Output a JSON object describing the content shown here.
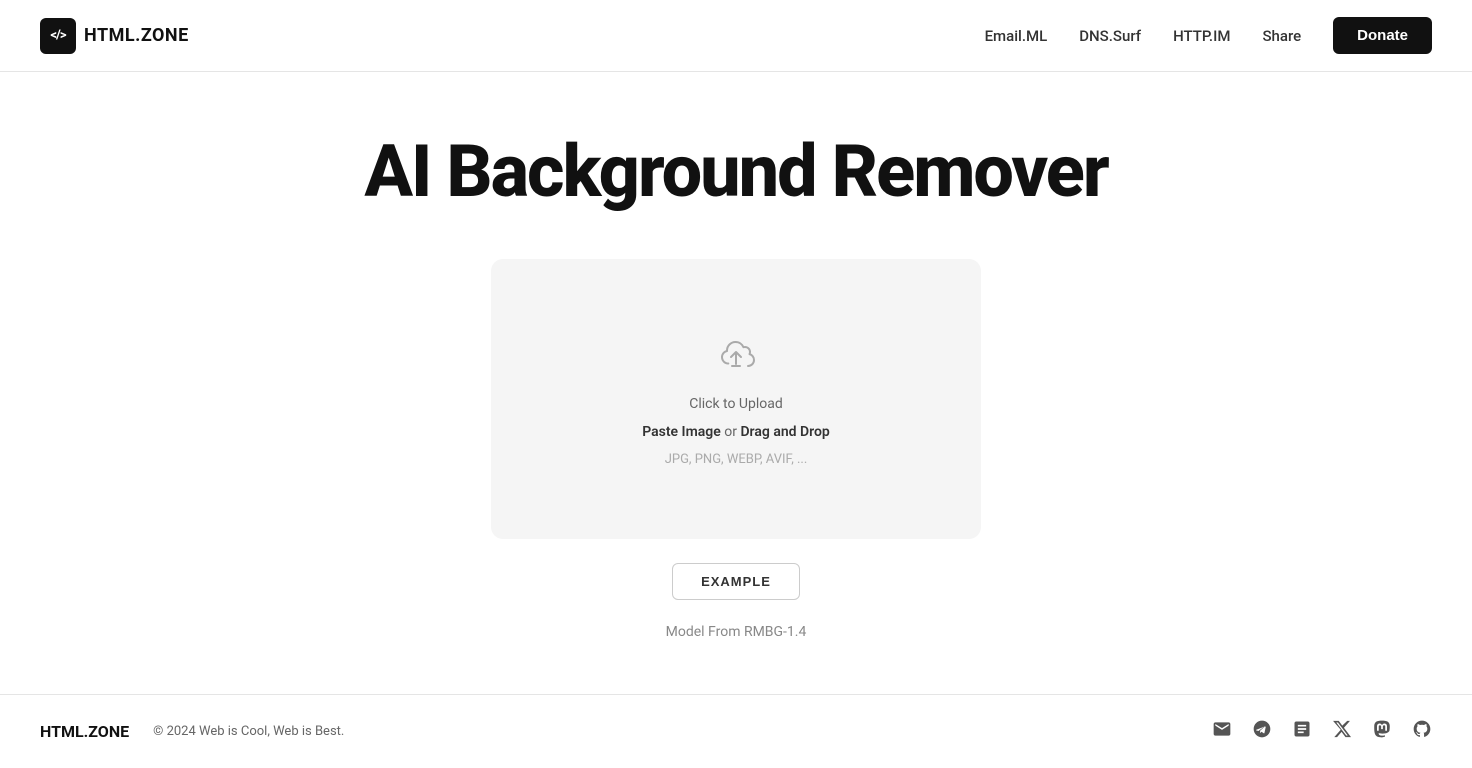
{
  "header": {
    "logo_text": "HTML.ZONE",
    "logo_icon_text": "</>",
    "nav": {
      "items": [
        {
          "label": "Email.ML",
          "href": "#"
        },
        {
          "label": "DNS.Surf",
          "href": "#"
        },
        {
          "label": "HTTP.IM",
          "href": "#"
        },
        {
          "label": "Share",
          "href": "#"
        }
      ]
    },
    "donate_label": "Donate"
  },
  "main": {
    "title": "AI Background Remover",
    "upload": {
      "primary_text": "Click to Upload",
      "secondary_text_prefix": "Paste Image",
      "secondary_text_middle": " or ",
      "secondary_text_highlight": "Drag and Drop",
      "formats": "JPG, PNG, WEBP, AVIF, ..."
    },
    "example_button": "EXAMPLE",
    "model_info": "Model From RMBG-1.4"
  },
  "footer": {
    "logo": "HTML.ZONE",
    "copyright": "© 2024 Web is Cool, Web is Best.",
    "icons": [
      {
        "name": "email-icon",
        "symbol": "✉"
      },
      {
        "name": "telegram-icon",
        "symbol": "✈"
      },
      {
        "name": "blog-icon",
        "symbol": "📝"
      },
      {
        "name": "twitter-icon",
        "symbol": "𝕏"
      },
      {
        "name": "mastodon-icon",
        "symbol": "🐘"
      },
      {
        "name": "github-icon",
        "symbol": "⬡"
      }
    ]
  }
}
